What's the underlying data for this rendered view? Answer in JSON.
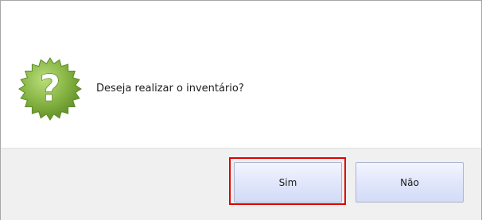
{
  "dialog": {
    "message": "Deseja realizar o inventário?",
    "icon": "question-badge-icon",
    "icon_color": "#7fae3a"
  },
  "buttons": {
    "yes_label": "Sim",
    "no_label": "Não"
  },
  "highlight": {
    "target": "yes-button",
    "color": "#e00000"
  }
}
